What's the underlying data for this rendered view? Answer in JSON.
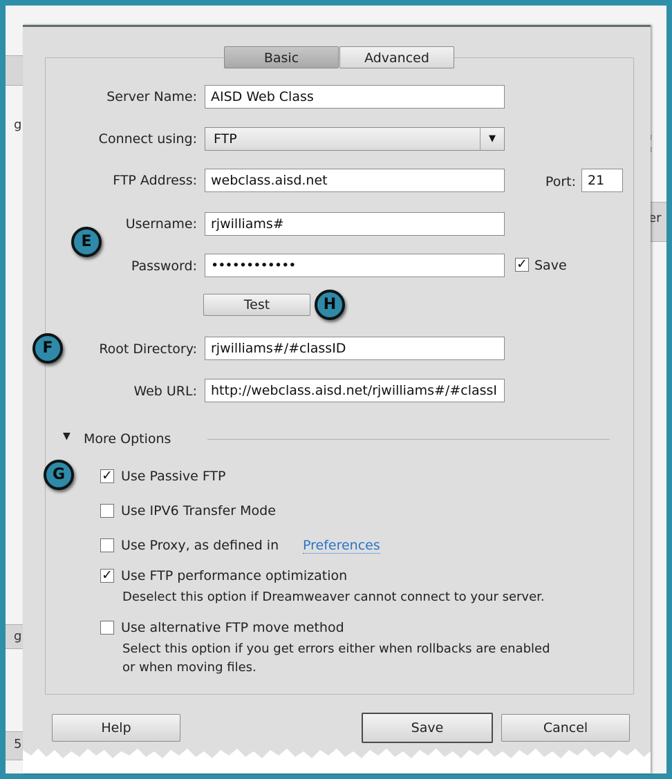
{
  "background": {
    "fragments": [
      "g",
      "g",
      "er",
      "5"
    ]
  },
  "tabs": {
    "basic": "Basic",
    "advanced": "Advanced"
  },
  "form": {
    "server_name_label": "Server Name:",
    "server_name_value": "AISD Web Class",
    "connect_using_label": "Connect using:",
    "connect_using_value": "FTP",
    "ftp_address_label": "FTP Address:",
    "ftp_address_value": "webclass.aisd.net",
    "port_label": "Port:",
    "port_value": "21",
    "username_label": "Username:",
    "username_value": "rjwilliams#",
    "password_label": "Password:",
    "password_value": "••••••••••••",
    "save_password_label": "Save",
    "test_button": "Test",
    "root_directory_label": "Root Directory:",
    "root_directory_value": "rjwilliams#/#classID",
    "web_url_label": "Web URL:",
    "web_url_value": "http://webclass.aisd.net/rjwilliams#/#classI"
  },
  "more_options": {
    "toggle_label": "More Options",
    "passive_ftp": "Use Passive FTP",
    "ipv6": "Use IPV6 Transfer Mode",
    "proxy": "Use Proxy, as defined in",
    "preferences_link": "Preferences",
    "ftp_optimization": "Use FTP performance optimization",
    "ftp_optimization_help": "Deselect this option if Dreamweaver cannot connect to your server.",
    "alt_move": "Use alternative FTP move method",
    "alt_move_help_1": "Select this option if you get errors either when rollbacks are enabled",
    "alt_move_help_2": "or when moving files."
  },
  "buttons": {
    "help": "Help",
    "save": "Save",
    "cancel": "Cancel"
  },
  "annotations": {
    "e": "E",
    "f": "F",
    "g": "G",
    "h": "H"
  },
  "colors": {
    "frame": "#2f8fa8",
    "badge": "#2e8aa8",
    "dialog_bg": "#dedede",
    "link": "#2a74c9"
  }
}
